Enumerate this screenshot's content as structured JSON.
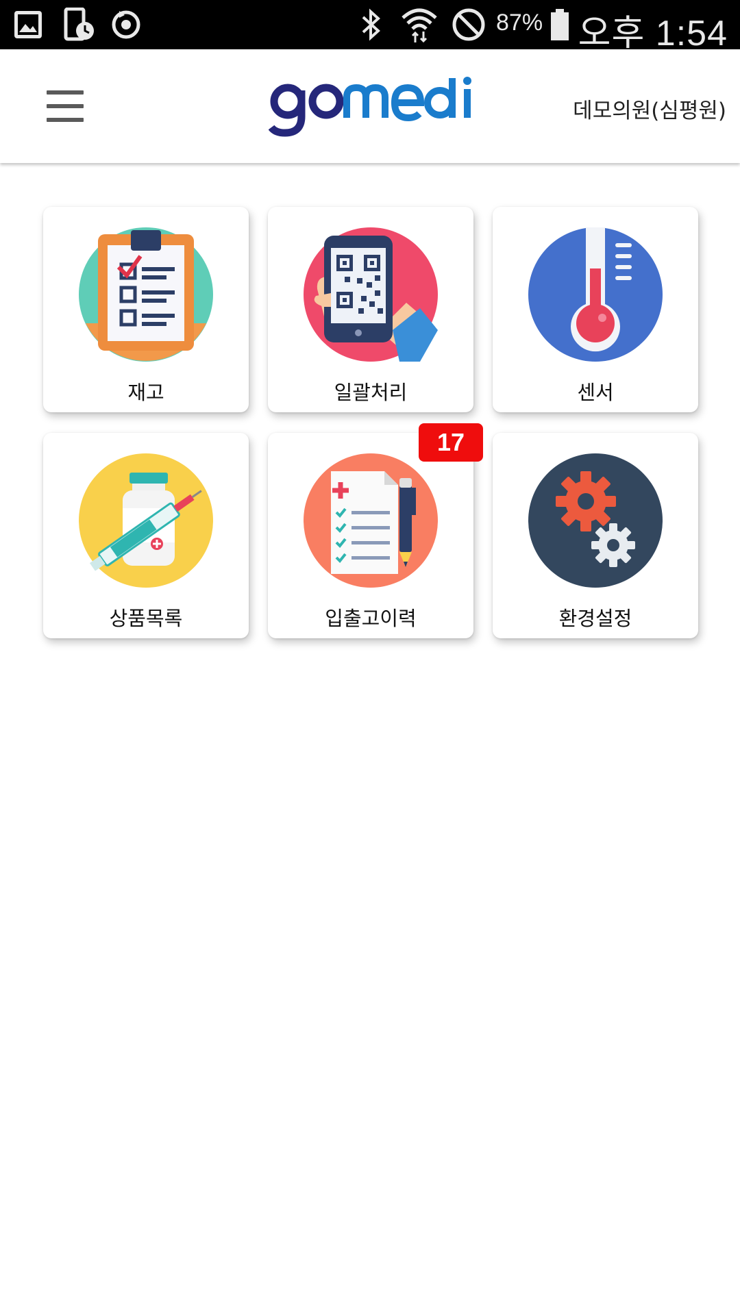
{
  "status_bar": {
    "battery_percent": "87%",
    "time": "오후 1:54"
  },
  "header": {
    "logo": "gomedi",
    "clinic_name": "데모의원(심평원)"
  },
  "menu": [
    {
      "label": "재고",
      "icon": "clipboard-checklist-icon"
    },
    {
      "label": "일괄처리",
      "icon": "qr-phone-icon"
    },
    {
      "label": "센서",
      "icon": "thermometer-icon"
    },
    {
      "label": "상품목록",
      "icon": "medicine-syringe-icon"
    },
    {
      "label": "입출고이력",
      "icon": "document-pen-icon",
      "badge": "17"
    },
    {
      "label": "환경설정",
      "icon": "gears-icon"
    }
  ],
  "colors": {
    "logo_go": "#25277a",
    "logo_medi": "#1a7ccc",
    "badge": "#ef0d0d"
  }
}
